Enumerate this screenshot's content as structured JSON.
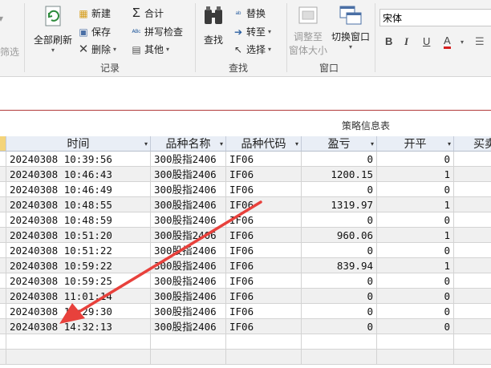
{
  "ribbon": {
    "filter_label": "筛选",
    "refresh_all": "全部刷新",
    "new": "新建",
    "save": "保存",
    "delete": "删除",
    "records_group": "记录",
    "totals": "合计",
    "spelling": "拼写检查",
    "more": "其他",
    "find": "查找",
    "replace": "替换",
    "goto": "转至",
    "select": "选择",
    "find_group": "查找",
    "size_to_fit_1": "调整至",
    "size_to_fit_2": "窗体大小",
    "switch_windows": "切换窗口",
    "window_group": "窗口",
    "font_name": "宋体",
    "bold": "B",
    "italic": "I",
    "underline": "U",
    "font_color": "A"
  },
  "form_title": "策略信息表",
  "columns": [
    "时间",
    "品种名称",
    "品种代码",
    "盈亏",
    "开平",
    "买卖"
  ],
  "rows": [
    [
      "20240308 10:39:56",
      "300股指2406",
      "IF06",
      "0",
      "0"
    ],
    [
      "20240308 10:46:43",
      "300股指2406",
      "IF06",
      "1200.15",
      "1"
    ],
    [
      "20240308 10:46:49",
      "300股指2406",
      "IF06",
      "0",
      "0"
    ],
    [
      "20240308 10:48:55",
      "300股指2406",
      "IF06",
      "1319.97",
      "1"
    ],
    [
      "20240308 10:48:59",
      "300股指2406",
      "IF06",
      "0",
      "0"
    ],
    [
      "20240308 10:51:20",
      "300股指2406",
      "IF06",
      "960.06",
      "1"
    ],
    [
      "20240308 10:51:22",
      "300股指2406",
      "IF06",
      "0",
      "0"
    ],
    [
      "20240308 10:59:22",
      "300股指2406",
      "IF06",
      "839.94",
      "1"
    ],
    [
      "20240308 10:59:25",
      "300股指2406",
      "IF06",
      "0",
      "0"
    ],
    [
      "20240308 11:01:14",
      "300股指2406",
      "IF06",
      "0",
      "0"
    ],
    [
      "20240308 14:29:30",
      "300股指2406",
      "IF06",
      "0",
      "0"
    ],
    [
      "20240308 14:32:13",
      "300股指2406",
      "IF06",
      "0",
      "0"
    ]
  ],
  "colors": {
    "arrow": "#e8413c",
    "title_rule": "#b23a3a",
    "header_bg": "#e9eef6"
  }
}
